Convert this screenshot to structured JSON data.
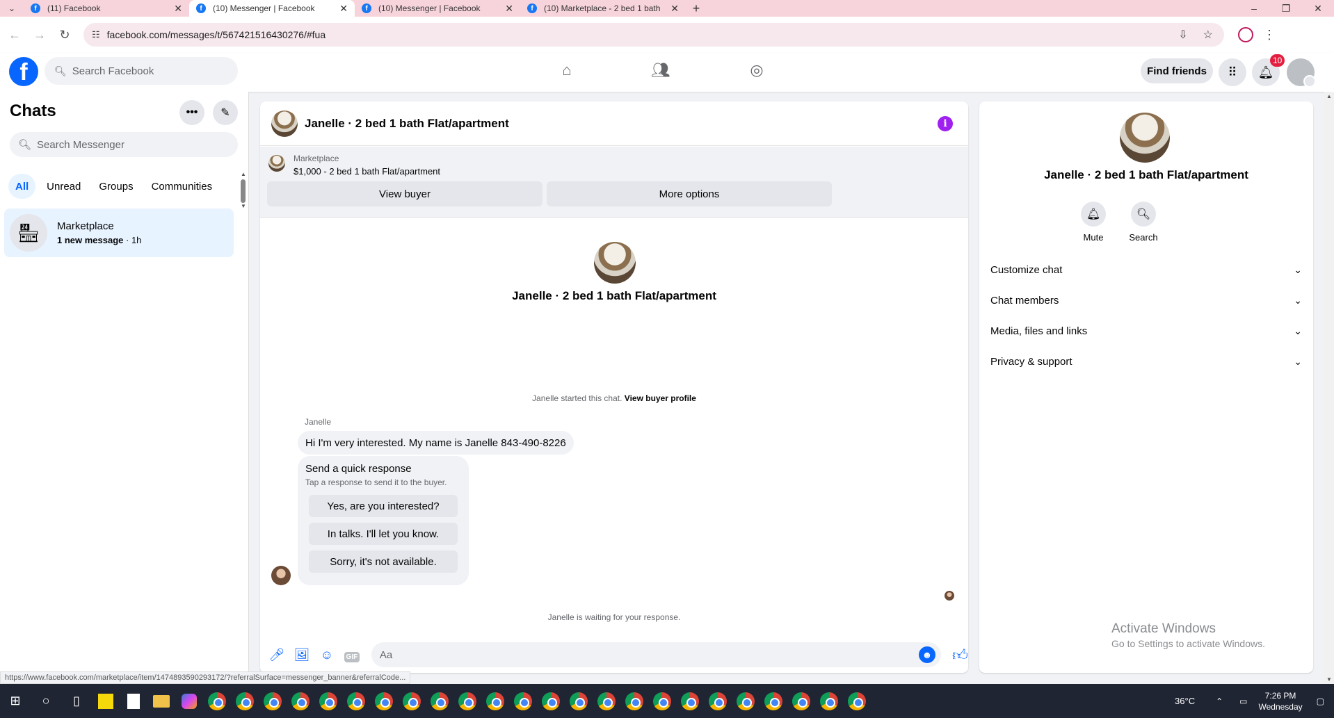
{
  "browser": {
    "tabs": [
      {
        "title": "(11) Facebook",
        "active": false
      },
      {
        "title": "(10) Messenger | Facebook",
        "active": true
      },
      {
        "title": "(10) Messenger | Facebook",
        "active": false
      },
      {
        "title": "(10) Marketplace - 2 bed 1 bath",
        "active": false
      }
    ],
    "url": "facebook.com/messages/t/567421516430276/#fua",
    "status_url": "https://www.facebook.com/marketplace/item/1474893590293172/?referralSurface=messenger_banner&referralCode..."
  },
  "fb_header": {
    "logo_letter": "f",
    "search_placeholder": "Search Facebook",
    "find_friends_label": "Find friends",
    "notification_count": "10",
    "brand_color": "#0866ff"
  },
  "chats": {
    "title": "Chats",
    "search_placeholder": "Search Messenger",
    "filters": [
      "All",
      "Unread",
      "Groups",
      "Communities"
    ],
    "active_filter": "All",
    "items": [
      {
        "name": "Marketplace",
        "preview_bold": "1 new message",
        "time": " · 1h"
      }
    ]
  },
  "conversation": {
    "title": "Janelle · 2 bed 1 bath Flat/apartment",
    "banner_label": "Marketplace",
    "banner_listing": "$1,000 - 2 bed 1 bath Flat/apartment",
    "view_buyer_label": "View buyer",
    "more_options_label": "More options",
    "center_title": "Janelle · 2 bed 1 bath Flat/apartment",
    "started_text": "Janelle started this chat.",
    "view_buyer_profile_label": "View buyer profile",
    "sender_name": "Janelle",
    "message_text": "Hi I'm very interested. My name is Janelle 843-490-8226",
    "quick_response_title": "Send a quick response",
    "quick_response_sub": "Tap a response to send it to the buyer.",
    "quick_responses": [
      "Yes, are you interested?",
      "In talks. I'll let you know.",
      "Sorry, it's not available."
    ],
    "waiting_text": "Janelle is waiting for your response.",
    "composer_placeholder": "Aa",
    "gif_label": "GIF"
  },
  "info_panel": {
    "title": "Janelle · 2 bed 1 bath Flat/apartment",
    "actions": [
      {
        "label": "Mute",
        "icon": "bell-icon"
      },
      {
        "label": "Search",
        "icon": "search-icon"
      }
    ],
    "sections": [
      "Customize chat",
      "Chat members",
      "Media, files and links",
      "Privacy & support"
    ],
    "activate_title": "Activate Windows",
    "activate_sub": "Go to Settings to activate Windows."
  },
  "taskbar": {
    "temperature": "36°C",
    "time": "7:26 PM",
    "day": "Wednesday"
  }
}
